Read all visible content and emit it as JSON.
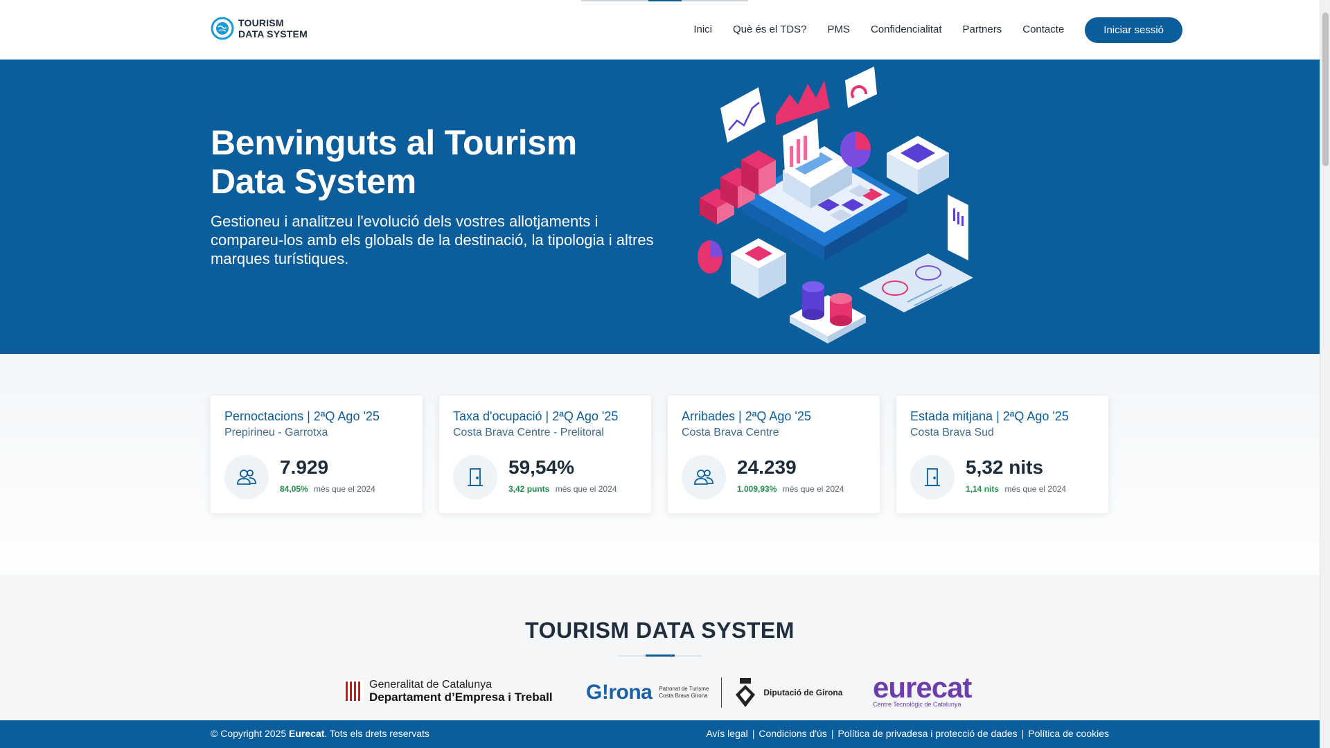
{
  "header": {
    "logo_line1": "TOURISM",
    "logo_line2": "DATA SYSTEM",
    "nav": [
      "Inici",
      "Què és el TDS?",
      "PMS",
      "Confidencialitat",
      "Partners",
      "Contacte"
    ],
    "login_label": "Iniciar sessió"
  },
  "hero": {
    "title": "Benvinguts al Tourism Data System",
    "subtitle": "Gestioneu i analitzeu l'evolució dels vostres allotjaments i compareu-los amb els globals de la destinació, la tipologia i altres marques turístiques."
  },
  "cards": [
    {
      "title": "Pernoctacions | 2ªQ Ago '25",
      "subtitle": "Prepirineu - Garrotxa",
      "icon": "users-icon",
      "value": "7.929",
      "delta": "84,05%",
      "compare": "més que el 2024"
    },
    {
      "title": "Taxa d'ocupació | 2ªQ Ago '25",
      "subtitle": "Costa Brava Centre - Prelitoral",
      "icon": "door-icon",
      "value": "59,54%",
      "delta": "3,42 punts",
      "compare": "més que el 2024"
    },
    {
      "title": "Arribades | 2ªQ Ago '25",
      "subtitle": "Costa Brava Centre",
      "icon": "users-icon",
      "value": "24.239",
      "delta": "1.009,93%",
      "compare": "més que el 2024"
    },
    {
      "title": "Estada mitjana | 2ªQ Ago '25",
      "subtitle": "Costa Brava Sud",
      "icon": "door-icon",
      "value": "5,32 nits",
      "delta": "1,14 nits",
      "compare": "més que el 2024"
    }
  ],
  "partners": {
    "title": "TOURISM DATA SYSTEM",
    "generalitat_l1": "Generalitat de Catalunya",
    "generalitat_l2": "Departament d’Empresa i Treball",
    "girona_word": "G!rona",
    "girona_small1": "Patronat de Turisme",
    "girona_small2": "Costa Brava Girona",
    "diputacio": "Diputació de Girona",
    "eurecat_word": "eurecat",
    "eurecat_sub": "Centre Tecnològic de Catalunya"
  },
  "footer": {
    "copy_prefix": "© Copyright 2025 ",
    "copy_brand": "Eurecat",
    "copy_suffix": ". Tots els drets reservats",
    "links": [
      "Avís legal",
      "Condicions d'ús",
      "Política de privadesa i protecció de dades",
      "Política de cookies"
    ]
  },
  "colors": {
    "primary": "#0b5d9c",
    "positive": "#1e8f4a",
    "accent_pink": "#e8336f",
    "accent_purple": "#6d3dab"
  }
}
